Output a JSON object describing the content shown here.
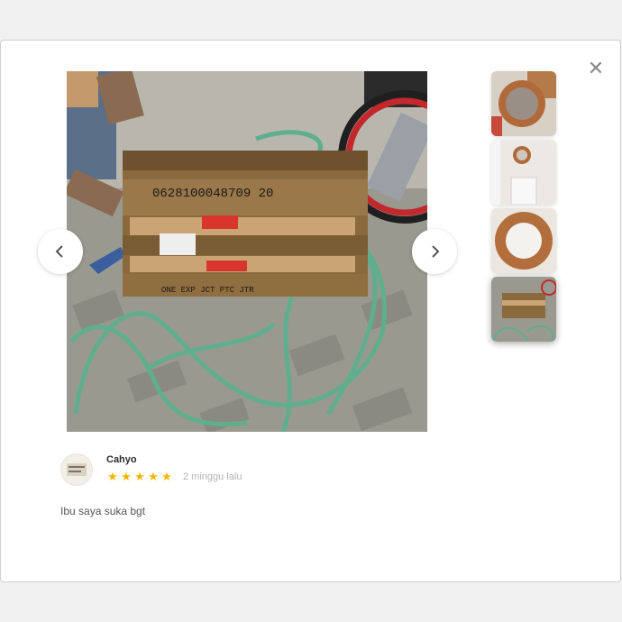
{
  "modal": {
    "close_icon": "close-icon",
    "close_glyph": "✕"
  },
  "gallery": {
    "prev_icon": "chevron-left-icon",
    "next_icon": "chevron-right-icon",
    "active_index": 3,
    "thumbnails": [
      {
        "name": "thumb-round-mirror-on-floor"
      },
      {
        "name": "thumb-mirror-on-wall"
      },
      {
        "name": "thumb-round-mirror-closeup"
      },
      {
        "name": "thumb-wooden-crate"
      }
    ],
    "main_photo_label": "0628100048709 20",
    "crate_marks": "ONE EXP  JCT PTC  JTR"
  },
  "review": {
    "reviewer_name": "Cahyo",
    "rating": 5,
    "stars": [
      "★",
      "★",
      "★",
      "★",
      "★"
    ],
    "time_ago": "2 minggu lalu",
    "text": "Ibu saya suka bgt"
  },
  "colors": {
    "star": "#f5b400",
    "hose": "#5fae8e",
    "crate": "#8a6a3c"
  }
}
